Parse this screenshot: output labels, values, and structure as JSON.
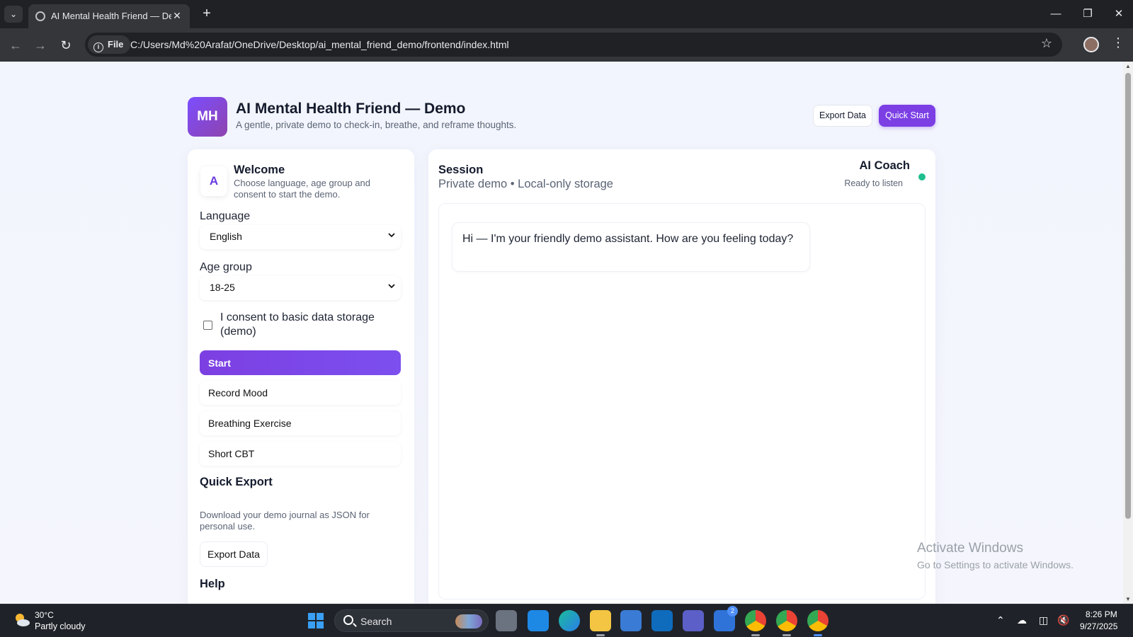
{
  "browser": {
    "tab_title": "AI Mental Health Friend — Demo",
    "address_scheme": "File",
    "address_url": "C:/Users/Md%20Arafat/OneDrive/Desktop/ai_mental_friend_demo/frontend/index.html"
  },
  "app": {
    "logo_text": "MH",
    "title": "AI Mental Health Friend — Demo",
    "subtitle": "A gentle, private demo to check-in, breathe, and reframe thoughts.",
    "export_button": "Export Data",
    "quick_start_button": "Quick Start",
    "accent_color": "#7b3fe4"
  },
  "sidebar": {
    "avatar_letter": "A",
    "welcome_title": "Welcome",
    "welcome_desc": "Choose language, age group and consent to start the demo.",
    "language_label": "Language",
    "language_value": "English",
    "age_label": "Age group",
    "age_value": "18-25",
    "consent_label": "I consent to basic data storage (demo)",
    "consent_checked": false,
    "start_button": "Start",
    "actions": [
      "Record Mood",
      "Breathing Exercise",
      "Short CBT"
    ],
    "quick_export_title": "Quick Export",
    "quick_export_desc": "Download your demo journal as JSON for personal use.",
    "quick_export_button": "Export Data",
    "help_title": "Help"
  },
  "session": {
    "title": "Session",
    "subtitle": "Private demo • Local-only storage",
    "coach_name": "AI Coach",
    "coach_status": "Ready to listen",
    "status_color": "#1fbf8f",
    "messages": [
      {
        "sender": "assistant",
        "text": "Hi — I'm your friendly demo assistant. How are you feeling today?"
      }
    ]
  },
  "watermark": {
    "line1": "Activate Windows",
    "line2": "Go to Settings to activate Windows."
  },
  "taskbar": {
    "weather_temp": "30°C",
    "weather_desc": "Partly cloudy",
    "search_placeholder": "Search",
    "teams_badge": "2",
    "time": "8:26 PM",
    "date": "9/27/2025"
  }
}
